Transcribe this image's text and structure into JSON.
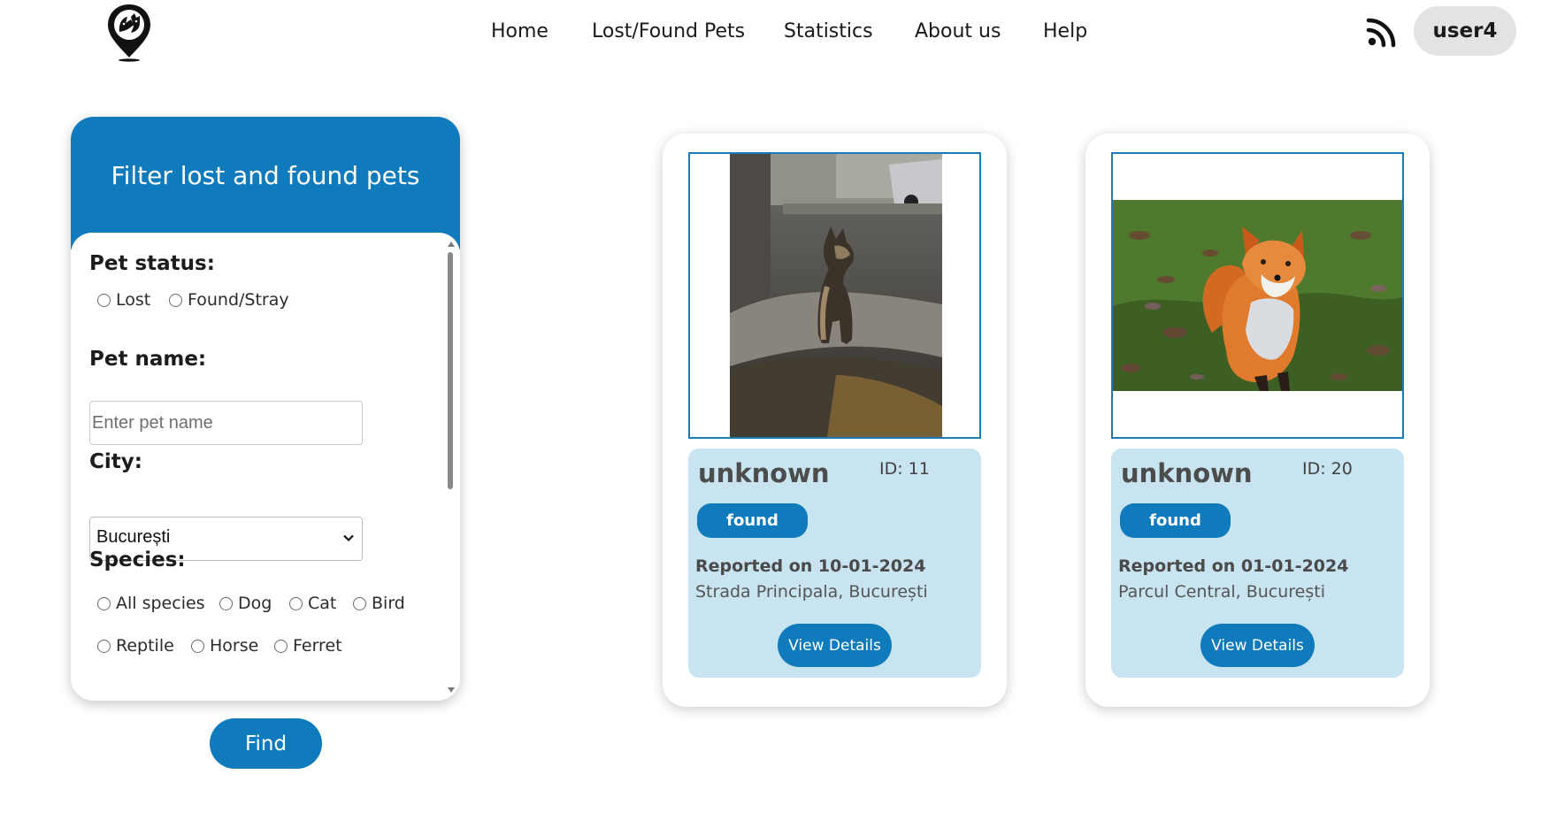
{
  "header": {
    "nav": [
      {
        "label": "Home"
      },
      {
        "label": "Lost/Found Pets"
      },
      {
        "label": "Statistics"
      },
      {
        "label": "About us"
      },
      {
        "label": "Help"
      }
    ],
    "user": "user4",
    "icons": {
      "logo": "pet-location-pin-logo",
      "feed": "rss-icon"
    }
  },
  "filter": {
    "title": "Filter lost and found pets",
    "status_label": "Pet status:",
    "status_options": [
      "Lost",
      "Found/Stray"
    ],
    "name_label": "Pet name:",
    "name_placeholder": "Enter pet name",
    "city_label": "City:",
    "city_selected": "București",
    "species_label": "Species:",
    "species_options": [
      "All species",
      "Dog",
      "Cat",
      "Bird",
      "Reptile",
      "Horse",
      "Ferret"
    ],
    "find_label": "Find"
  },
  "pets": [
    {
      "name": "unknown",
      "id": "ID: 11",
      "status": "found",
      "reported": "Reported on 10-01-2024",
      "location": "Strada Principala, București",
      "button": "View Details",
      "photo": "dog-sitting-on-sidewalk"
    },
    {
      "name": "unknown",
      "id": "ID: 20",
      "status": "found",
      "reported": "Reported on 01-01-2024",
      "location": "Parcul Central, București",
      "button": "View Details",
      "photo": "red-fox-on-grass"
    }
  ],
  "colors": {
    "accent": "#0f7bbd",
    "card_info": "#c8e4f0",
    "pill": "#e3e3e3"
  }
}
